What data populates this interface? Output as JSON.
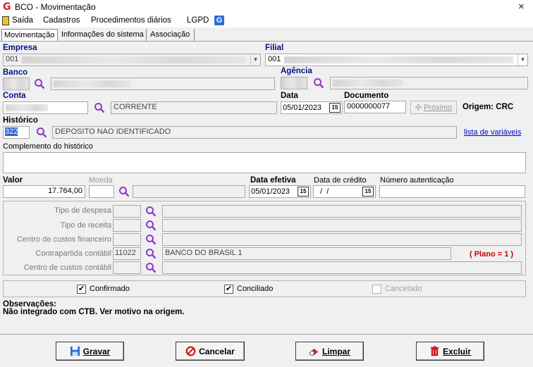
{
  "window": {
    "title": "BCO - Movimentação",
    "close": "×"
  },
  "menu": [
    "Saída",
    "Cadastros",
    "Procedimentos diários",
    "LGPD"
  ],
  "tabs": [
    "Movimentação",
    "Informações do sistema",
    "Associação"
  ],
  "empresa": {
    "label": "Empresa",
    "value": "001"
  },
  "filial": {
    "label": "Filial",
    "value": "001"
  },
  "banco": {
    "label": "Banco"
  },
  "agencia": {
    "label": "Agência"
  },
  "conta": {
    "label": "Conta",
    "tipo": "CORRENTE"
  },
  "data": {
    "label": "Data",
    "value": "05/01/2023"
  },
  "documento": {
    "label": "Documento",
    "value": "0000000077"
  },
  "proximo": {
    "label": "Próximo"
  },
  "origem": "Origem: CRC",
  "historico": {
    "label": "Histórico",
    "code": "322",
    "desc": "DEPOSITO NAO IDENTIFICADO",
    "link": "lista de variáveis"
  },
  "complemento": {
    "label": "Complemento do histórico",
    "value": ""
  },
  "valor": {
    "label": "Valor",
    "value": "17.764,00"
  },
  "moeda": {
    "label": "Moeda"
  },
  "data_efetiva": {
    "label": "Data efetiva",
    "value": "05/01/2023"
  },
  "data_credito": {
    "label": "Data de crédito",
    "value": " /  /"
  },
  "num_autenticacao": {
    "label": "Número autenticação",
    "value": ""
  },
  "group": {
    "tipo_despesa": "Tipo de despesa",
    "tipo_receita": "Tipo de receita",
    "cc_financeiro": "Centro de custos financeiro",
    "contrapartida": "Contrapartida contábil",
    "contrapartida_code": "11022",
    "contrapartida_desc": "BANCO DO BRASIL 1",
    "plano": "( Plano = 1 )",
    "cc_contabil": "Centro de custos contábil"
  },
  "checks": {
    "confirmado": {
      "label": "Confirmado",
      "checked": true
    },
    "conciliado": {
      "label": "Conciliado",
      "checked": true
    },
    "cancelado": {
      "label": "Cancelado",
      "checked": false
    }
  },
  "observacoes": {
    "label": "Observações:",
    "text": "Não integrado com CTB. Ver motivo na origem."
  },
  "buttons": {
    "gravar": "Gravar",
    "cancelar": "Cancelar",
    "limpar": "Limpar",
    "excluir": "Excluir"
  },
  "colors": {
    "label_blue": "#00108a",
    "plano_red": "#c00000",
    "accent_purple": "#8a3ccc"
  }
}
